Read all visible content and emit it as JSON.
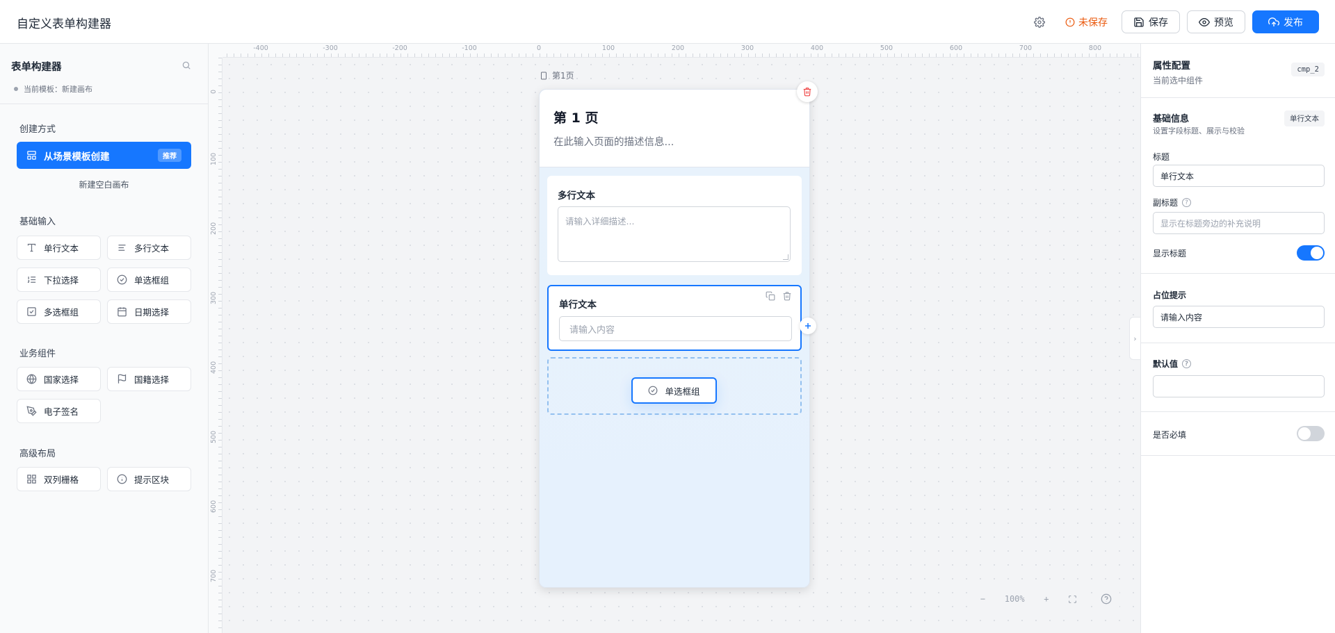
{
  "header": {
    "title": "自定义表单构建器",
    "unsaved_label": "未保存",
    "save_label": "保存",
    "preview_label": "预览",
    "publish_label": "发布"
  },
  "sidebar": {
    "title": "表单构建器",
    "template_label": "当前模板：新建画布",
    "create_section": "创建方式",
    "create_from_template": "从场景模板创建",
    "recommended_badge": "推荐",
    "create_blank": "新建空白画布",
    "groups": [
      {
        "title": "基础输入",
        "items": [
          {
            "label": "单行文本",
            "icon": "text-icon"
          },
          {
            "label": "多行文本",
            "icon": "paragraph-icon"
          },
          {
            "label": "下拉选择",
            "icon": "list-icon"
          },
          {
            "label": "单选框组",
            "icon": "check-circle-icon"
          },
          {
            "label": "多选框组",
            "icon": "checkbox-icon"
          },
          {
            "label": "日期选择",
            "icon": "calendar-icon"
          }
        ]
      },
      {
        "title": "业务组件",
        "items": [
          {
            "label": "国家选择",
            "icon": "globe-icon"
          },
          {
            "label": "国籍选择",
            "icon": "flag-icon"
          },
          {
            "label": "电子签名",
            "icon": "pen-icon"
          }
        ]
      },
      {
        "title": "高级布局",
        "items": [
          {
            "label": "双列栅格",
            "icon": "grid-icon"
          },
          {
            "label": "提示区块",
            "icon": "info-icon"
          }
        ]
      }
    ]
  },
  "canvas": {
    "ruler_x": [
      "-400",
      "-300",
      "-200",
      "-100",
      "0",
      "100",
      "200",
      "300",
      "400",
      "500",
      "600",
      "700",
      "800"
    ],
    "ruler_y": [
      "0",
      "100",
      "200",
      "300",
      "400",
      "500",
      "600",
      "700"
    ],
    "page_label": "第1页",
    "page_title": "第 1 页",
    "page_desc": "在此输入页面的描述信息...",
    "fields": {
      "multiline_label": "多行文本",
      "multiline_placeholder": "请输入详细描述...",
      "single_label": "单行文本",
      "single_placeholder": "请输入内容"
    },
    "drag_chip_label": "单选框组",
    "zoom": "100%"
  },
  "properties": {
    "title": "属性配置",
    "subtitle": "当前选中组件",
    "component_id": "cmp_2",
    "basic_title": "基础信息",
    "basic_sub": "设置字段标题、展示与校验",
    "basic_tag": "单行文本",
    "title_label": "标题",
    "title_value": "单行文本",
    "subtitle_label": "副标题",
    "subtitle_placeholder": "显示在标题旁边的补充说明",
    "show_title_label": "显示标题",
    "show_title": true,
    "placeholder_label": "占位提示",
    "placeholder_value": "请输入内容",
    "default_label": "默认值",
    "default_value": "",
    "required_label": "是否必填",
    "required": false
  },
  "colors": {
    "accent": "#1677ff",
    "warning": "#ea580c",
    "danger": "#ef4444"
  }
}
